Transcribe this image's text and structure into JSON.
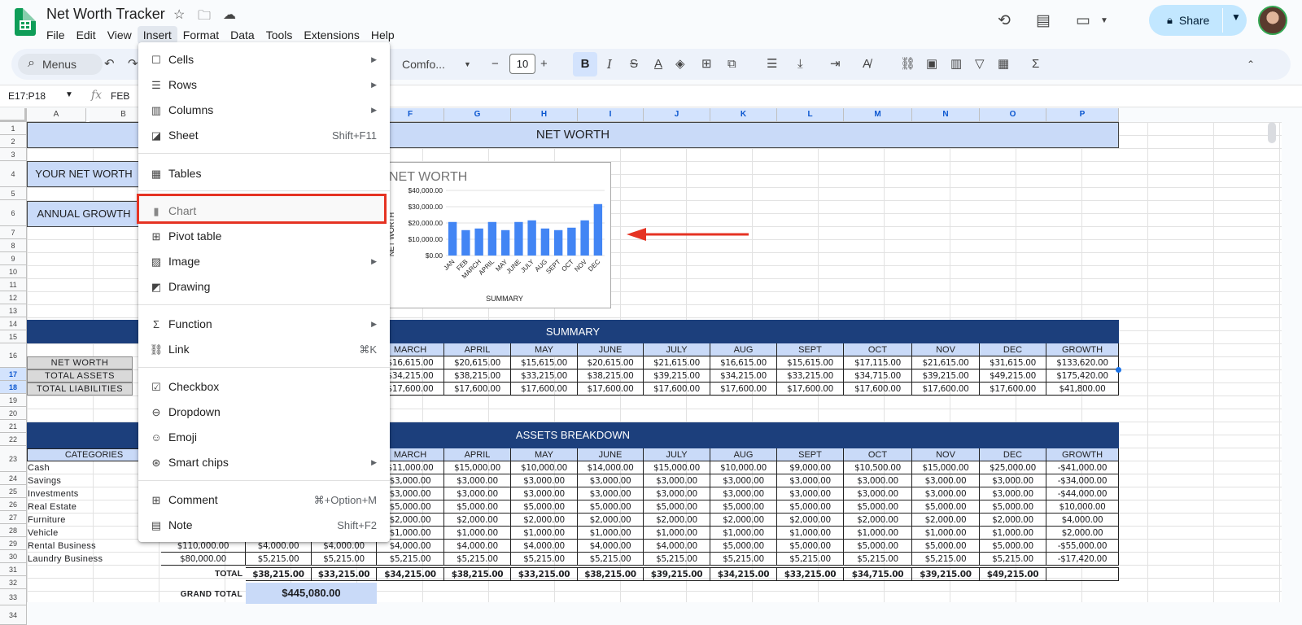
{
  "app": {
    "title": "Net Worth Tracker",
    "share_label": "Share"
  },
  "menubar": [
    "File",
    "Edit",
    "View",
    "Insert",
    "Format",
    "Data",
    "Tools",
    "Extensions",
    "Help"
  ],
  "toolbar": {
    "search_label": "Menus",
    "font": "Comfo...",
    "font_size": "10",
    "bold": "B",
    "italic": "I",
    "strike": "S",
    "text_color": "A",
    "sigma": "Σ"
  },
  "formula_bar": {
    "name_box": "E17:P18",
    "fx": "fx",
    "value": "FEB"
  },
  "columns": [
    "A",
    "B",
    "F",
    "G",
    "H",
    "I",
    "J",
    "K",
    "L",
    "M",
    "N",
    "O",
    "P"
  ],
  "rows": [
    "1",
    "2",
    "3",
    "4",
    "5",
    "6",
    "7",
    "8",
    "9",
    "10",
    "11",
    "12",
    "13",
    "14",
    "15",
    "16",
    "17",
    "18",
    "19",
    "20",
    "21",
    "22",
    "23",
    "24",
    "25",
    "26",
    "27",
    "28",
    "29",
    "30",
    "31",
    "32",
    "33",
    "34"
  ],
  "sheet": {
    "title_band": "NET WORTH",
    "your_net_worth": "YOUR NET WORTH",
    "annual_growth": "ANNUAL GROWTH",
    "summary_band": "SUMMARY",
    "assets_band": "ASSETS BREAKDOWN",
    "months": [
      "MARCH",
      "APRIL",
      "MAY",
      "JUNE",
      "JULY",
      "AUG",
      "SEPT",
      "OCT",
      "NOV",
      "DEC",
      "GROWTH"
    ],
    "summary_labels": [
      "NET WORTH",
      "TOTAL ASSETS",
      "TOTAL LIABILITIES"
    ],
    "summary_rows": [
      [
        "$16,615.00",
        "$20,615.00",
        "$15,615.00",
        "$20,615.00",
        "$21,615.00",
        "$16,615.00",
        "$15,615.00",
        "$17,115.00",
        "$21,615.00",
        "$31,615.00",
        "$133,620.00"
      ],
      [
        "$34,215.00",
        "$38,215.00",
        "$33,215.00",
        "$38,215.00",
        "$39,215.00",
        "$34,215.00",
        "$33,215.00",
        "$34,715.00",
        "$39,215.00",
        "$49,215.00",
        "$175,420.00"
      ],
      [
        "$17,600.00",
        "$17,600.00",
        "$17,600.00",
        "$17,600.00",
        "$17,600.00",
        "$17,600.00",
        "$17,600.00",
        "$17,600.00",
        "$17,600.00",
        "$17,600.00",
        "$41,800.00"
      ]
    ],
    "categories_header": "CATEGORIES",
    "categories": [
      "Cash",
      "Savings",
      "Investments",
      "Real Estate",
      "Furniture",
      "Vehicle",
      "Rental Business",
      "Laundry Business"
    ],
    "assets_rows": [
      [
        "",
        "",
        "",
        "$11,000.00",
        "$15,000.00",
        "$10,000.00",
        "$14,000.00",
        "$15,000.00",
        "$10,000.00",
        "$9,000.00",
        "$10,500.00",
        "$15,000.00",
        "$25,000.00",
        "-$41,000.00"
      ],
      [
        "",
        "",
        "",
        "$3,000.00",
        "$3,000.00",
        "$3,000.00",
        "$3,000.00",
        "$3,000.00",
        "$3,000.00",
        "$3,000.00",
        "$3,000.00",
        "$3,000.00",
        "$3,000.00",
        "-$34,000.00"
      ],
      [
        "",
        "",
        "",
        "$3,000.00",
        "$3,000.00",
        "$3,000.00",
        "$3,000.00",
        "$3,000.00",
        "$3,000.00",
        "$3,000.00",
        "$3,000.00",
        "$3,000.00",
        "$3,000.00",
        "-$44,000.00"
      ],
      [
        "",
        "",
        "",
        "$5,000.00",
        "$5,000.00",
        "$5,000.00",
        "$5,000.00",
        "$5,000.00",
        "$5,000.00",
        "$5,000.00",
        "$5,000.00",
        "$5,000.00",
        "$5,000.00",
        "$10,000.00"
      ],
      [
        "",
        "",
        "",
        "$2,000.00",
        "$2,000.00",
        "$2,000.00",
        "$2,000.00",
        "$2,000.00",
        "$2,000.00",
        "$2,000.00",
        "$2,000.00",
        "$2,000.00",
        "$2,000.00",
        "$4,000.00"
      ],
      [
        "",
        "",
        "",
        "$1,000.00",
        "$1,000.00",
        "$1,000.00",
        "$1,000.00",
        "$1,000.00",
        "$1,000.00",
        "$1,000.00",
        "$1,000.00",
        "$1,000.00",
        "$1,000.00",
        "$2,000.00"
      ],
      [
        "$110,000.00",
        "$4,000.00",
        "$4,000.00",
        "$4,000.00",
        "$4,000.00",
        "$4,000.00",
        "$4,000.00",
        "$4,000.00",
        "$5,000.00",
        "$5,000.00",
        "$5,000.00",
        "$5,000.00",
        "$5,000.00",
        "-$55,000.00"
      ],
      [
        "$80,000.00",
        "$5,215.00",
        "$5,215.00",
        "$5,215.00",
        "$5,215.00",
        "$5,215.00",
        "$5,215.00",
        "$5,215.00",
        "$5,215.00",
        "$5,215.00",
        "$5,215.00",
        "$5,215.00",
        "$5,215.00",
        "-$17,420.00"
      ]
    ],
    "total_label": "TOTAL",
    "total_row": [
      "$38,215.00",
      "$33,215.00",
      "$34,215.00",
      "$38,215.00",
      "$33,215.00",
      "$38,215.00",
      "$39,215.00",
      "$34,215.00",
      "$33,215.00",
      "$34,715.00",
      "$39,215.00",
      "$49,215.00",
      ""
    ],
    "grand_total_label": "GRAND TOTAL",
    "grand_total_value": "$445,080.00"
  },
  "menu": {
    "items": [
      {
        "label": "Cells",
        "icon": "cells-icon",
        "submenu": true
      },
      {
        "label": "Rows",
        "icon": "rows-icon",
        "submenu": true
      },
      {
        "label": "Columns",
        "icon": "columns-icon",
        "submenu": true
      },
      {
        "label": "Sheet",
        "icon": "sheet-icon",
        "shortcut": "Shift+F11"
      },
      {
        "label": "Tables",
        "icon": "tables-icon"
      },
      {
        "label": "Chart",
        "icon": "chart-icon"
      },
      {
        "label": "Pivot table",
        "icon": "pivot-table-icon"
      },
      {
        "label": "Image",
        "icon": "image-icon",
        "submenu": true
      },
      {
        "label": "Drawing",
        "icon": "drawing-icon"
      },
      {
        "label": "Function",
        "icon": "function-icon",
        "submenu": true
      },
      {
        "label": "Link",
        "icon": "link-icon",
        "shortcut": "⌘K"
      },
      {
        "label": "Checkbox",
        "icon": "checkbox-icon"
      },
      {
        "label": "Dropdown",
        "icon": "dropdown-icon"
      },
      {
        "label": "Emoji",
        "icon": "emoji-icon"
      },
      {
        "label": "Smart chips",
        "icon": "smart-chips-icon",
        "submenu": true
      },
      {
        "label": "Comment",
        "icon": "comment-icon",
        "shortcut": "⌘+Option+M"
      },
      {
        "label": "Note",
        "icon": "note-icon",
        "shortcut": "Shift+F2"
      }
    ]
  },
  "colors": {
    "band": "#1c3f7c",
    "light": "#c9daf8",
    "bar": "#4285f4",
    "highlight": "#e53323",
    "share": "#c2e7ff"
  },
  "chart_data": {
    "type": "bar",
    "title": "NET WORTH",
    "xlabel": "SUMMARY",
    "ylabel": "NET WORTH",
    "categories": [
      "JAN",
      "FEB",
      "MARCH",
      "APRIL",
      "MAY",
      "JUNE",
      "JULY",
      "AUG",
      "SEPT",
      "OCT",
      "NOV",
      "DEC"
    ],
    "values": [
      20615,
      15615,
      16615,
      20615,
      15615,
      20615,
      21615,
      16615,
      15615,
      17115,
      21615,
      31615
    ],
    "yticks": [
      "$0.00",
      "$10,000.00",
      "$20,000.00",
      "$30,000.00",
      "$40,000.00"
    ],
    "ylim": [
      0,
      40000
    ],
    "grid": true
  }
}
